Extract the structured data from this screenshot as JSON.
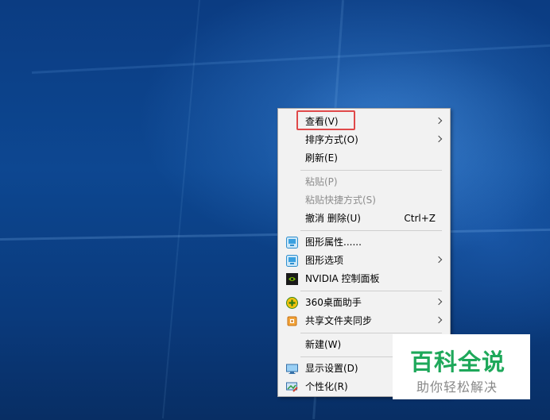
{
  "context_menu": {
    "items": [
      {
        "label": "查看(V)",
        "has_submenu": true
      },
      {
        "label": "排序方式(O)",
        "has_submenu": true
      },
      {
        "label": "刷新(E)"
      },
      {
        "label": "粘贴(P)",
        "disabled": true
      },
      {
        "label": "粘贴快捷方式(S)",
        "disabled": true
      },
      {
        "label": "撤消 删除(U)",
        "shortcut": "Ctrl+Z"
      },
      {
        "label": "图形属性......",
        "icon": "intel-graphics-icon"
      },
      {
        "label": "图形选项",
        "icon": "intel-graphics-icon",
        "has_submenu": true
      },
      {
        "label": "NVIDIA 控制面板",
        "icon": "nvidia-icon"
      },
      {
        "label": "360桌面助手",
        "icon": "360-desktop-icon",
        "has_submenu": true
      },
      {
        "label": "共享文件夹同步",
        "icon": "shared-folder-sync-icon",
        "has_submenu": true
      },
      {
        "label": "新建(W)"
      },
      {
        "label": "显示设置(D)",
        "icon": "display-icon"
      },
      {
        "label": "个性化(R)",
        "icon": "personalize-icon"
      }
    ]
  },
  "watermark": {
    "title": "百科全说",
    "subtitle": "助你轻松解决"
  },
  "colors": {
    "highlight_border": "#e0494a",
    "watermark_green": "#1ea85a"
  }
}
